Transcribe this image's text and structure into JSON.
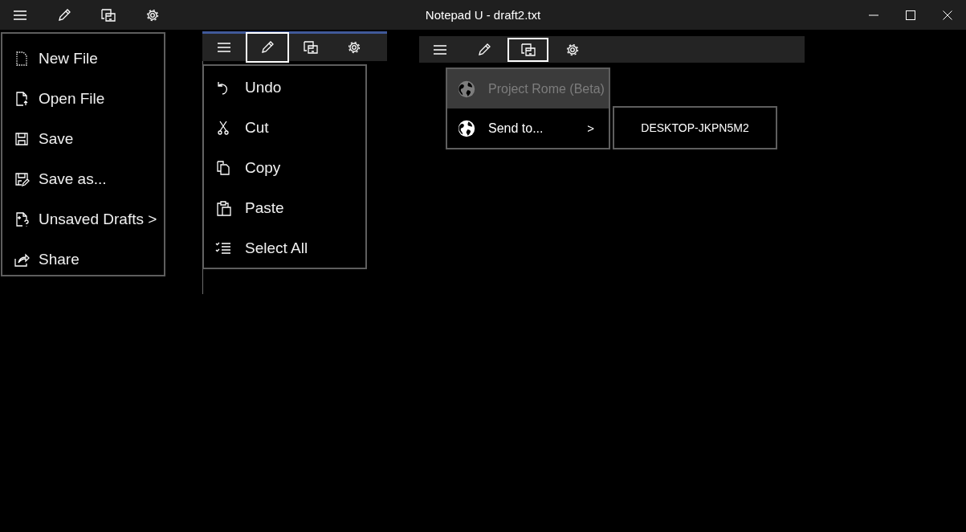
{
  "window": {
    "title": "Notepad U - draft2.txt"
  },
  "title_bar_toolbar": [
    {
      "kind": "menu"
    },
    {
      "kind": "edit"
    },
    {
      "kind": "devices"
    },
    {
      "kind": "settings"
    }
  ],
  "file_menu": [
    {
      "kind": "new",
      "label": "New File"
    },
    {
      "kind": "open",
      "label": "Open File"
    },
    {
      "kind": "save",
      "label": "Save"
    },
    {
      "kind": "saveas",
      "label": "Save as..."
    },
    {
      "kind": "drafts",
      "label": "Unsaved Drafts >"
    },
    {
      "kind": "share",
      "label": "Share"
    }
  ],
  "edit_panel": {
    "toolbar": [
      {
        "kind": "menu",
        "selected": false
      },
      {
        "kind": "edit",
        "selected": true
      },
      {
        "kind": "devices",
        "selected": false
      },
      {
        "kind": "settings",
        "selected": false
      }
    ],
    "menu": [
      {
        "kind": "undo",
        "label": "Undo"
      },
      {
        "kind": "cut",
        "label": "Cut"
      },
      {
        "kind": "copy",
        "label": "Copy"
      },
      {
        "kind": "paste",
        "label": "Paste"
      },
      {
        "kind": "selectall",
        "label": "Select All"
      }
    ]
  },
  "share_panel": {
    "toolbar": [
      {
        "kind": "menu",
        "selected": false
      },
      {
        "kind": "edit",
        "selected": false
      },
      {
        "kind": "devices",
        "selected": true
      },
      {
        "kind": "settings",
        "selected": false
      }
    ],
    "menu": [
      {
        "label": "Project Rome (Beta)",
        "disabled": true
      },
      {
        "label": "Send to...",
        "disabled": false,
        "arrow": ">"
      }
    ],
    "devices": [
      "DESKTOP-JKPN5M2"
    ]
  }
}
